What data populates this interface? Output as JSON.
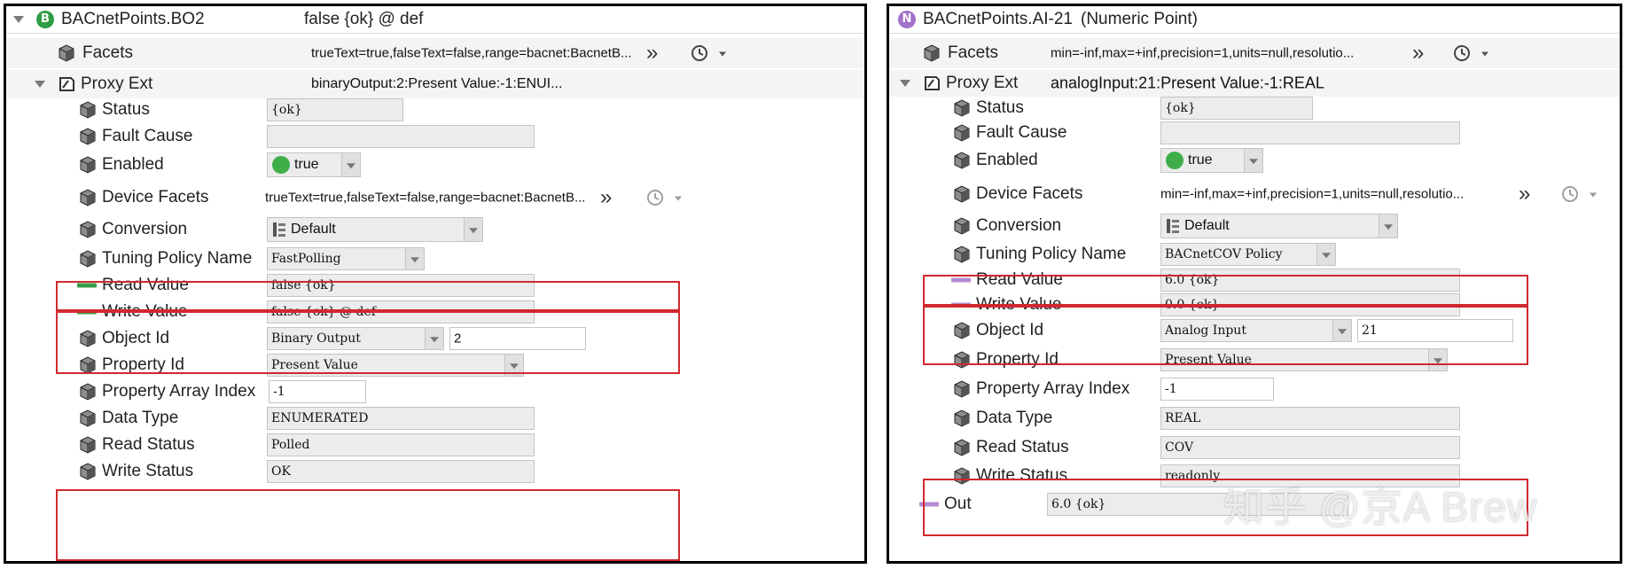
{
  "left": {
    "header": {
      "icon": "B",
      "title": "BACnetPoints.BO2",
      "value": "false {ok} @ def"
    },
    "facets": {
      "label": "Facets",
      "value": "trueText=true,falseText=false,range=bacnet:BacnetB..."
    },
    "proxy": {
      "label": "Proxy Ext",
      "value": "binaryOutput:2:Present Value:-1:ENUI..."
    },
    "rows": {
      "status": {
        "label": "Status",
        "value": "{ok}"
      },
      "fault": {
        "label": "Fault Cause",
        "value": ""
      },
      "enabled": {
        "label": "Enabled",
        "value": "true"
      },
      "device_facets": {
        "label": "Device Facets",
        "value": "trueText=true,falseText=false,range=bacnet:BacnetB..."
      },
      "conversion": {
        "label": "Conversion",
        "value": "Default"
      },
      "tuning": {
        "label": "Tuning Policy Name",
        "value": "FastPolling"
      },
      "read_value": {
        "label": "Read Value",
        "value": "false {ok}"
      },
      "write_value": {
        "label": "Write Value",
        "value": "false {ok} @ def"
      },
      "object_id": {
        "label": "Object Id",
        "type": "Binary Output",
        "instance": "2"
      },
      "property_id": {
        "label": "Property Id",
        "value": "Present Value"
      },
      "array_index": {
        "label": "Property Array Index",
        "value": "-1"
      },
      "data_type": {
        "label": "Data Type",
        "value": "ENUMERATED"
      },
      "read_status": {
        "label": "Read Status",
        "value": "Polled"
      },
      "write_status": {
        "label": "Write Status",
        "value": "OK"
      }
    }
  },
  "right": {
    "header": {
      "icon": "N",
      "title": "BACnetPoints.AI-21",
      "subtitle": "(Numeric Point)"
    },
    "facets": {
      "label": "Facets",
      "value": "min=-inf,max=+inf,precision=1,units=null,resolutio..."
    },
    "proxy": {
      "label": "Proxy Ext",
      "value": "analogInput:21:Present Value:-1:REAL"
    },
    "rows": {
      "status": {
        "label": "Status",
        "value": "{ok}"
      },
      "fault": {
        "label": "Fault Cause",
        "value": ""
      },
      "enabled": {
        "label": "Enabled",
        "value": "true"
      },
      "device_facets": {
        "label": "Device Facets",
        "value": "min=-inf,max=+inf,precision=1,units=null,resolutio..."
      },
      "conversion": {
        "label": "Conversion",
        "value": "Default"
      },
      "tuning": {
        "label": "Tuning Policy Name",
        "value": "BACnetCOV Policy"
      },
      "read_value": {
        "label": "Read Value",
        "value": "6.0 {ok}"
      },
      "write_value": {
        "label": "Write Value",
        "value": "0.0 {ok}"
      },
      "object_id": {
        "label": "Object Id",
        "type": "Analog Input",
        "instance": "21"
      },
      "property_id": {
        "label": "Property Id",
        "value": "Present Value"
      },
      "array_index": {
        "label": "Property Array Index",
        "value": "-1"
      },
      "data_type": {
        "label": "Data Type",
        "value": "REAL"
      },
      "read_status": {
        "label": "Read Status",
        "value": "COV"
      },
      "write_status": {
        "label": "Write Status",
        "value": "readonly"
      },
      "out": {
        "label": "Out",
        "value": "6.0 {ok}"
      }
    }
  },
  "watermark": "知乎 @京A Brew",
  "colors": {
    "badge_bool": "#2e9e43",
    "badge_numeric": "#a271c8",
    "enabled_dot": "#3fae49",
    "bool_dash": "#3a9a48",
    "numeric_dash": "#b48bd2",
    "highlight": "#d0282e",
    "field_bg": "#ececec"
  },
  "icons": [
    "expand-triangle-icon",
    "boolean-point-icon",
    "numeric-point-icon",
    "property-cube-icon",
    "proxy-ext-icon",
    "double-chevron-icon",
    "clock-icon",
    "conversion-icon"
  ]
}
